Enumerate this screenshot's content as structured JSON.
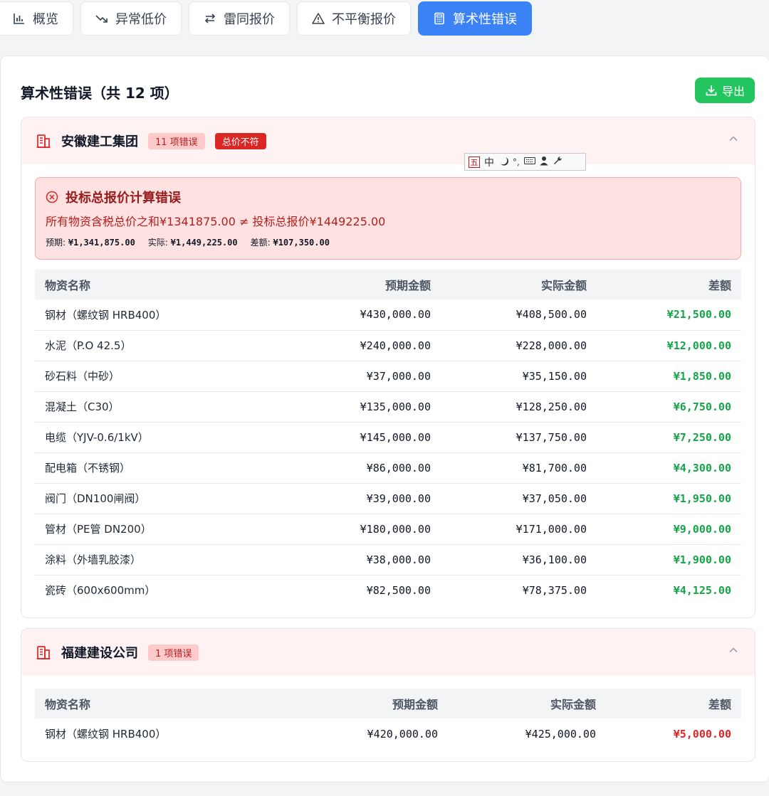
{
  "tabs": [
    {
      "label": "概览",
      "icon": "bar-chart-icon",
      "active": false
    },
    {
      "label": "异常低价",
      "icon": "trend-down-icon",
      "active": false
    },
    {
      "label": "雷同报价",
      "icon": "swap-icon",
      "active": false
    },
    {
      "label": "不平衡报价",
      "icon": "warning-icon",
      "active": false
    },
    {
      "label": "算术性错误",
      "icon": "calculator-icon",
      "active": true
    }
  ],
  "panel": {
    "title": "算术性错误（共 12 项）",
    "export_label": "导出"
  },
  "ime_toolbar": {
    "five": "五",
    "zh": "中"
  },
  "companies": [
    {
      "name": "安徽建工集团",
      "error_count": "11 项错误",
      "tag": "总价不符",
      "error": {
        "title": "投标总报价计算错误",
        "desc": "所有物资含税总价之和¥1341875.00 ≠ 投标总报价¥1449225.00",
        "expected_label": "预期:",
        "expected": "¥1,341,875.00",
        "actual_label": "实际:",
        "actual": "¥1,449,225.00",
        "diff_label": "差额:",
        "diff": "¥107,350.00"
      },
      "table": {
        "headers": [
          "物资名称",
          "预期金额",
          "实际金额",
          "差额"
        ],
        "rows": [
          [
            "钢材（螺纹钢 HRB400）",
            "¥430,000.00",
            "¥408,500.00",
            "¥21,500.00"
          ],
          [
            "水泥（P.O 42.5）",
            "¥240,000.00",
            "¥228,000.00",
            "¥12,000.00"
          ],
          [
            "砂石料（中砂）",
            "¥37,000.00",
            "¥35,150.00",
            "¥1,850.00"
          ],
          [
            "混凝土（C30）",
            "¥135,000.00",
            "¥128,250.00",
            "¥6,750.00"
          ],
          [
            "电缆（YJV-0.6/1kV）",
            "¥145,000.00",
            "¥137,750.00",
            "¥7,250.00"
          ],
          [
            "配电箱（不锈钢）",
            "¥86,000.00",
            "¥81,700.00",
            "¥4,300.00"
          ],
          [
            "阀门（DN100闸阀）",
            "¥39,000.00",
            "¥37,050.00",
            "¥1,950.00"
          ],
          [
            "管材（PE管 DN200）",
            "¥180,000.00",
            "¥171,000.00",
            "¥9,000.00"
          ],
          [
            "涂料（外墙乳胶漆）",
            "¥38,000.00",
            "¥36,100.00",
            "¥1,900.00"
          ],
          [
            "瓷砖（600x600mm）",
            "¥82,500.00",
            "¥78,375.00",
            "¥4,125.00"
          ]
        ]
      }
    },
    {
      "name": "福建建设公司",
      "error_count": "1 项错误",
      "table": {
        "headers": [
          "物资名称",
          "预期金额",
          "实际金额",
          "差额"
        ],
        "rows": [
          [
            "钢材（螺纹钢 HRB400）",
            "¥420,000.00",
            "¥425,000.00",
            "¥5,000.00"
          ]
        ]
      }
    }
  ],
  "colors": {
    "accent": "#3b82f6",
    "export": "#22c55e",
    "positive": "#16a34a",
    "negative": "#dc2626",
    "error_bg": "#fee2e2"
  }
}
